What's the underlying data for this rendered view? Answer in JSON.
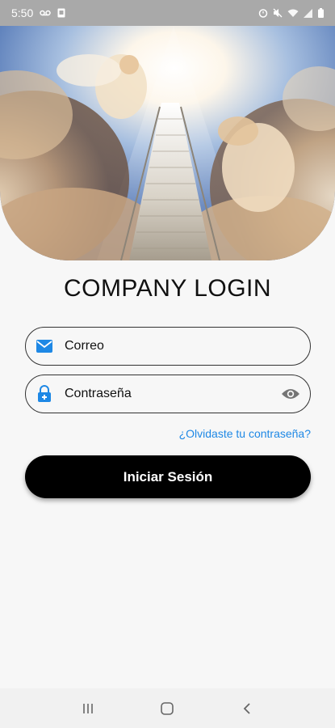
{
  "status_bar": {
    "time": "5:50",
    "left_icons": [
      "voicemail-icon",
      "sim-card-icon"
    ],
    "right_icons": [
      "alarm-icon",
      "mute-icon",
      "wifi-icon",
      "signal-icon",
      "battery-icon"
    ]
  },
  "hero": {
    "image": "heaven-stairway-angels"
  },
  "title": "COMPANY LOGIN",
  "email_field": {
    "placeholder": "Correo",
    "icon": "mail-icon",
    "icon_color": "#1e88e5"
  },
  "password_field": {
    "placeholder": "Contraseña",
    "icon": "lock-icon",
    "icon_color": "#1e88e5",
    "toggle_icon": "eye-icon"
  },
  "forgot_link": "¿Olvidaste tu contraseña?",
  "login_button": "Iniciar Sesión",
  "nav_bar": {
    "buttons": [
      "recent-apps-icon",
      "home-icon",
      "back-icon"
    ]
  },
  "colors": {
    "accent": "#1e88e5",
    "button_bg": "#000000",
    "background": "#f7f7f7"
  }
}
